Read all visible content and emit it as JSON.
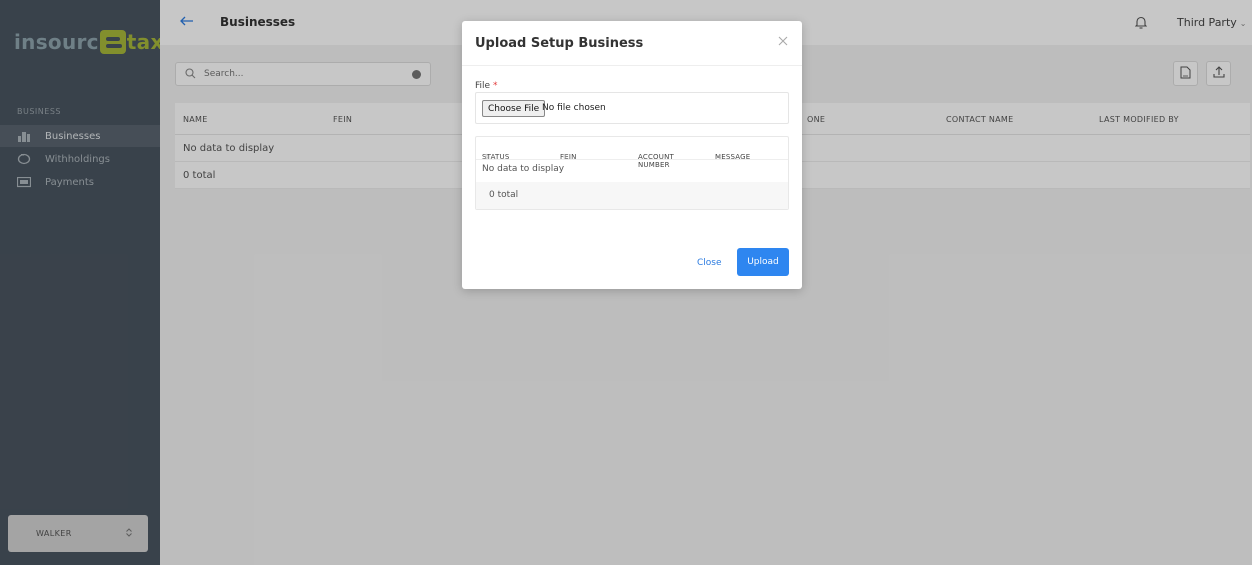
{
  "logo": {
    "part1": "insourc",
    "part2": "tax"
  },
  "sidebar": {
    "section_title": "BUSINESS",
    "items": [
      {
        "label": "Businesses",
        "icon": "building-icon",
        "active": true
      },
      {
        "label": "Withholdings",
        "icon": "piggy-bank-icon",
        "active": false
      },
      {
        "label": "Payments",
        "icon": "payment-icon",
        "active": false
      }
    ],
    "footer_label": "WALKER"
  },
  "header": {
    "title": "Businesses",
    "user": "Third Party"
  },
  "search": {
    "placeholder": "Search..."
  },
  "table": {
    "columns": [
      "NAME",
      "FEIN",
      "ONE",
      "CONTACT NAME",
      "LAST MODIFIED BY"
    ],
    "empty_text": "No data to display",
    "total_text": "0 total"
  },
  "modal": {
    "title": "Upload Setup Business",
    "file_label": "File",
    "required_mark": "*",
    "choose_button": "Choose File",
    "no_file_text": "No file chosen",
    "columns": [
      "STATUS",
      "FEIN",
      "ACCOUNT NUMBER",
      "MESSAGE"
    ],
    "empty_text": "No data to display",
    "total_text": "0 total",
    "close_label": "Close",
    "upload_label": "Upload"
  },
  "colors": {
    "accent": "#2e86f0",
    "sidebar": "#4a5560",
    "logo_green": "#a7b83a"
  }
}
